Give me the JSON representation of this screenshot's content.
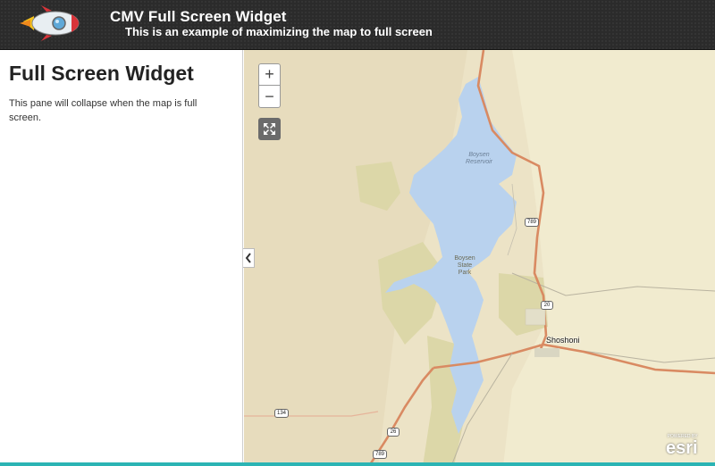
{
  "header": {
    "title": "CMV Full Screen Widget",
    "subtitle": "This is an example of maximizing the map to full screen",
    "logo_icon": "rocket-icon"
  },
  "left_pane": {
    "title": "Full Screen Widget",
    "description": "This pane will collapse when the map is full screen.",
    "collapse_icon": "chevron-left-icon"
  },
  "map": {
    "zoom_in_label": "+",
    "zoom_out_label": "−",
    "fullscreen_icon": "expand-icon",
    "labels": {
      "reservoir": "Boysen Reservoir",
      "park": "Boysen State Park",
      "town": "Shoshoni"
    },
    "shields": {
      "route_789_north": "789",
      "route_20": "20",
      "route_134": "134",
      "route_26": "26",
      "route_789_south": "789"
    },
    "attribution": {
      "powered_by": "POWERED BY",
      "brand": "esri"
    },
    "colors": {
      "water": "#b9d2ee",
      "land": "#ece3c6",
      "highway": "#d98a62",
      "park": "#dcd7a8",
      "accent": "#2bb4b4"
    }
  }
}
